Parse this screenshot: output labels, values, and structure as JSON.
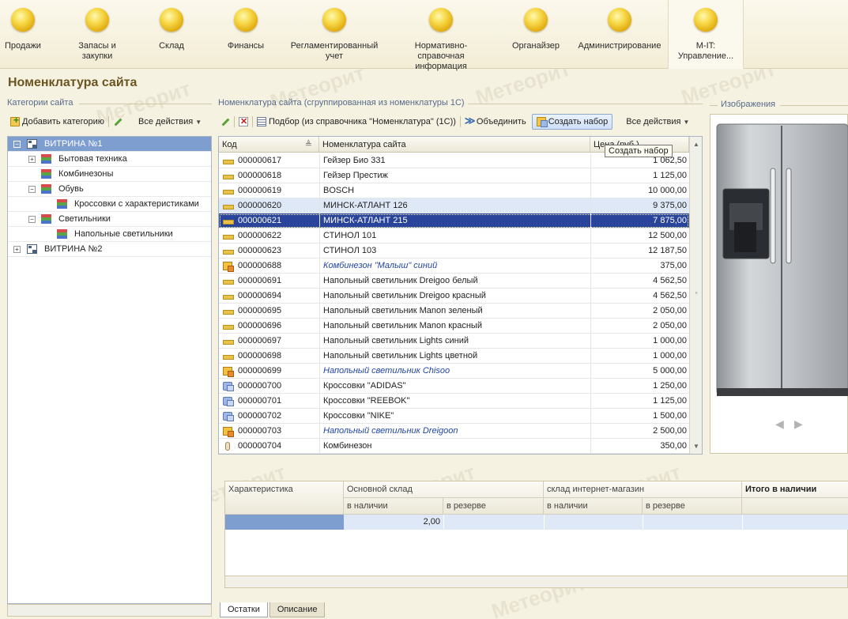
{
  "sections": [
    {
      "label": "Продажи"
    },
    {
      "label": "Запасы и закупки"
    },
    {
      "label": "Склад"
    },
    {
      "label": "Финансы"
    },
    {
      "label": "Регламентированный учет"
    },
    {
      "label": "Нормативно-справочная информация"
    },
    {
      "label": "Органайзер"
    },
    {
      "label": "Администрирование"
    },
    {
      "label": "M-IT: Управление..."
    }
  ],
  "page_title": "Номенклатура сайта",
  "categories": {
    "group_label": "Категории сайта",
    "add_label": "Добавить категорию",
    "all_actions": "Все действия",
    "tree": [
      {
        "label": "ВИТРИНА №1",
        "toggle": "⊖",
        "icon": "folder-icon"
      },
      {
        "label": "Бытовая техника",
        "toggle": "⊕",
        "icon": "category-icon"
      },
      {
        "label": "Комбинезоны",
        "toggle": "",
        "icon": "category-icon"
      },
      {
        "label": "Обувь",
        "toggle": "⊖",
        "icon": "category-icon"
      },
      {
        "label": "Кроссовки с характеристиками",
        "toggle": "",
        "icon": "category-icon"
      },
      {
        "label": "Светильники",
        "toggle": "⊖",
        "icon": "category-icon"
      },
      {
        "label": "Напольные светильники",
        "toggle": "",
        "icon": "category-icon"
      },
      {
        "label": "ВИТРИНА №2",
        "toggle": "⊕",
        "icon": "folder-icon"
      }
    ]
  },
  "nomenclature": {
    "group_label": "Номенклатура сайта (сгруппированная из номенклатуры 1С)",
    "pick_label": "Подбор (из справочника \"Номенклатура\" (1С))",
    "merge_label": "Объединить",
    "create_set_label": "Создать набор",
    "all_actions": "Все действия",
    "tooltip": "Создать набор",
    "columns": {
      "code": "Код",
      "name": "Номенклатура сайта",
      "price": "Цена (руб.)"
    },
    "rows": [
      {
        "code": "000000617",
        "name": "Гейзер Био 331",
        "price": "1 062,50",
        "icon": "item-icon",
        "italic": false
      },
      {
        "code": "000000618",
        "name": "Гейзер Престиж",
        "price": "1 125,00",
        "icon": "item-icon",
        "italic": false
      },
      {
        "code": "000000619",
        "name": "BOSCH",
        "price": "10 000,00",
        "icon": "item-icon",
        "italic": false
      },
      {
        "code": "000000620",
        "name": "МИНСК-АТЛАНТ 126",
        "price": "9 375,00",
        "icon": "item-icon",
        "italic": false
      },
      {
        "code": "000000621",
        "name": "МИНСК-АТЛАНТ 215",
        "price": "7 875,00",
        "icon": "item-icon",
        "italic": false
      },
      {
        "code": "000000622",
        "name": "СТИНОЛ 101",
        "price": "12 500,00",
        "icon": "item-icon",
        "italic": false
      },
      {
        "code": "000000623",
        "name": "СТИНОЛ 103",
        "price": "12 187,50",
        "icon": "item-icon",
        "italic": false
      },
      {
        "code": "000000688",
        "name": "Комбинезон \"Малыш\" синий",
        "price": "375,00",
        "icon": "set-icon",
        "italic": true
      },
      {
        "code": "000000691",
        "name": "Напольный светильник Dreigoo белый",
        "price": "4 562,50",
        "icon": "item-icon",
        "italic": false
      },
      {
        "code": "000000694",
        "name": "Напольный светильник Dreigoo красный",
        "price": "4 562,50",
        "icon": "item-icon",
        "italic": false
      },
      {
        "code": "000000695",
        "name": "Напольный светильник Manon зеленый",
        "price": "2 050,00",
        "icon": "item-icon",
        "italic": false
      },
      {
        "code": "000000696",
        "name": "Напольный светильник Manon красный",
        "price": "2 050,00",
        "icon": "item-icon",
        "italic": false
      },
      {
        "code": "000000697",
        "name": "Напольный светильник Lights синий",
        "price": "1 000,00",
        "icon": "item-icon",
        "italic": false
      },
      {
        "code": "000000698",
        "name": "Напольный светильник Lights цветной",
        "price": "1 000,00",
        "icon": "item-icon",
        "italic": false
      },
      {
        "code": "000000699",
        "name": "Напольный светильник Chisoo",
        "price": "5 000,00",
        "icon": "set-icon",
        "italic": true
      },
      {
        "code": "000000700",
        "name": "Кроссовки \"ADIDAS\"",
        "price": "1 250,00",
        "icon": "shoe-icon",
        "italic": false
      },
      {
        "code": "000000701",
        "name": "Кроссовки \"REEBOK\"",
        "price": "1 125,00",
        "icon": "shoe-icon",
        "italic": false
      },
      {
        "code": "000000702",
        "name": "Кроссовки \"NIKE\"",
        "price": "1 500,00",
        "icon": "shoe-icon",
        "italic": false
      },
      {
        "code": "000000703",
        "name": "Напольный светильник Dreigoon",
        "price": "2 500,00",
        "icon": "set-icon",
        "italic": true
      },
      {
        "code": "000000704",
        "name": "Комбинезон",
        "price": "350,00",
        "icon": "bottle-icon",
        "italic": false
      }
    ]
  },
  "images": {
    "group_label": "Изображения"
  },
  "stock": {
    "col_characteristic": "Характеристика",
    "main_warehouse": "Основной склад",
    "online_warehouse": "склад интернет-магазин",
    "total_label": "Итого в наличии",
    "in_stock": "в наличии",
    "reserved": "в резерве",
    "row_value": "2,00"
  },
  "tabs": [
    {
      "label": "Остатки"
    },
    {
      "label": "Описание"
    }
  ],
  "watermark": "Метеорит"
}
